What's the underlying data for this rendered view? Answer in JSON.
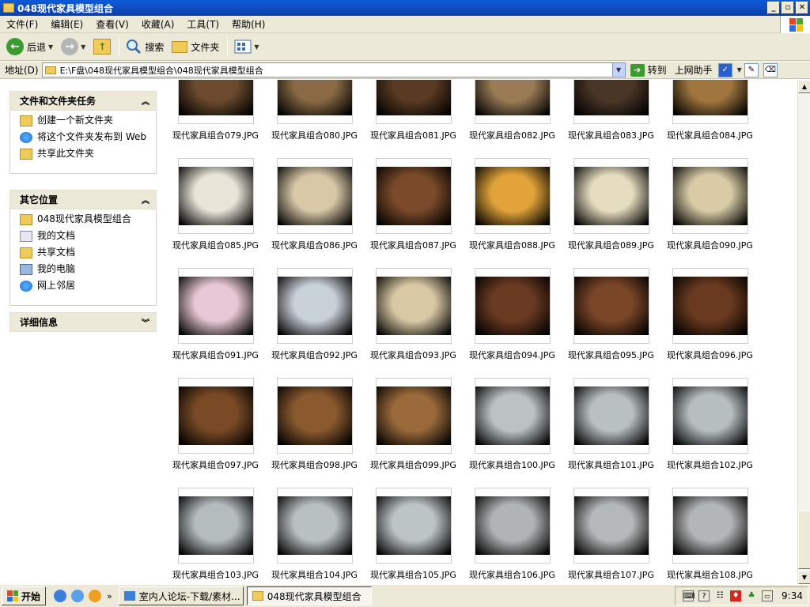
{
  "window": {
    "title": "048现代家具模型组合",
    "min_label": "_",
    "max_label": "▫",
    "close_label": "✕"
  },
  "menu": [
    "文件(F)",
    "编辑(E)",
    "查看(V)",
    "收藏(A)",
    "工具(T)",
    "帮助(H)"
  ],
  "toolbar": {
    "back_label": "后退",
    "search_label": "搜索",
    "folders_label": "文件夹"
  },
  "address": {
    "label": "地址(D)",
    "path": "E:\\F盘\\048现代家具模型组合\\048现代家具模型组合",
    "go_label": "转到",
    "helper_label": "上网助手"
  },
  "tasks_panel": {
    "title": "文件和文件夹任务",
    "items": [
      "创建一个新文件夹",
      "将这个文件夹发布到 Web",
      "共享此文件夹"
    ]
  },
  "places_panel": {
    "title": "其它位置",
    "items": [
      "048现代家具模型组合",
      "我的文档",
      "共享文档",
      "我的电脑",
      "网上邻居"
    ]
  },
  "details_panel": {
    "title": "详细信息"
  },
  "files": [
    {
      "name": "现代家具组合079.JPG",
      "tone": "#6b4a2e"
    },
    {
      "name": "现代家具组合080.JPG",
      "tone": "#8a6a44"
    },
    {
      "name": "现代家具组合081.JPG",
      "tone": "#5a3a22"
    },
    {
      "name": "现代家具组合082.JPG",
      "tone": "#9a7b55"
    },
    {
      "name": "现代家具组合083.JPG",
      "tone": "#4a3626"
    },
    {
      "name": "现代家具组合084.JPG",
      "tone": "#a0763e"
    },
    {
      "name": "现代家具组合085.JPG",
      "tone": "#e8e4d8"
    },
    {
      "name": "现代家具组合086.JPG",
      "tone": "#d8c8a8"
    },
    {
      "name": "现代家具组合087.JPG",
      "tone": "#7a4a2a"
    },
    {
      "name": "现代家具组合088.JPG",
      "tone": "#e2a43a"
    },
    {
      "name": "现代家具组合089.JPG",
      "tone": "#e6dcc0"
    },
    {
      "name": "现代家具组合090.JPG",
      "tone": "#d8cba6"
    },
    {
      "name": "现代家具组合091.JPG",
      "tone": "#e8c8d4"
    },
    {
      "name": "现代家具组合092.JPG",
      "tone": "#c8d0d8"
    },
    {
      "name": "现代家具组合093.JPG",
      "tone": "#d8c8a4"
    },
    {
      "name": "现代家具组合094.JPG",
      "tone": "#6a3a22"
    },
    {
      "name": "现代家具组合095.JPG",
      "tone": "#7a4628"
    },
    {
      "name": "现代家具组合096.JPG",
      "tone": "#6a3a20"
    },
    {
      "name": "现代家具组合097.JPG",
      "tone": "#7a4a26"
    },
    {
      "name": "现代家具组合098.JPG",
      "tone": "#8a5a2e"
    },
    {
      "name": "现代家具组合099.JPG",
      "tone": "#9a6a3a"
    },
    {
      "name": "现代家具组合100.JPG",
      "tone": "#bcc2c4"
    },
    {
      "name": "现代家具组合101.JPG",
      "tone": "#b8c0c2"
    },
    {
      "name": "现代家具组合102.JPG",
      "tone": "#b6bec0"
    },
    {
      "name": "现代家具组合103.JPG",
      "tone": "#b4bcbe"
    },
    {
      "name": "现代家具组合104.JPG",
      "tone": "#b8c0c0"
    },
    {
      "name": "现代家具组合105.JPG",
      "tone": "#bcc4c6"
    },
    {
      "name": "现代家具组合106.JPG",
      "tone": "#b0b4b4"
    },
    {
      "name": "现代家具组合107.JPG",
      "tone": "#b4b8b8"
    },
    {
      "name": "现代家具组合108.JPG",
      "tone": "#b2b6b6"
    }
  ],
  "taskbar": {
    "start_label": "开始",
    "buttons": [
      "室内人论坛-下载/素材...",
      "048现代家具模型组合"
    ],
    "clock": "9:34"
  }
}
